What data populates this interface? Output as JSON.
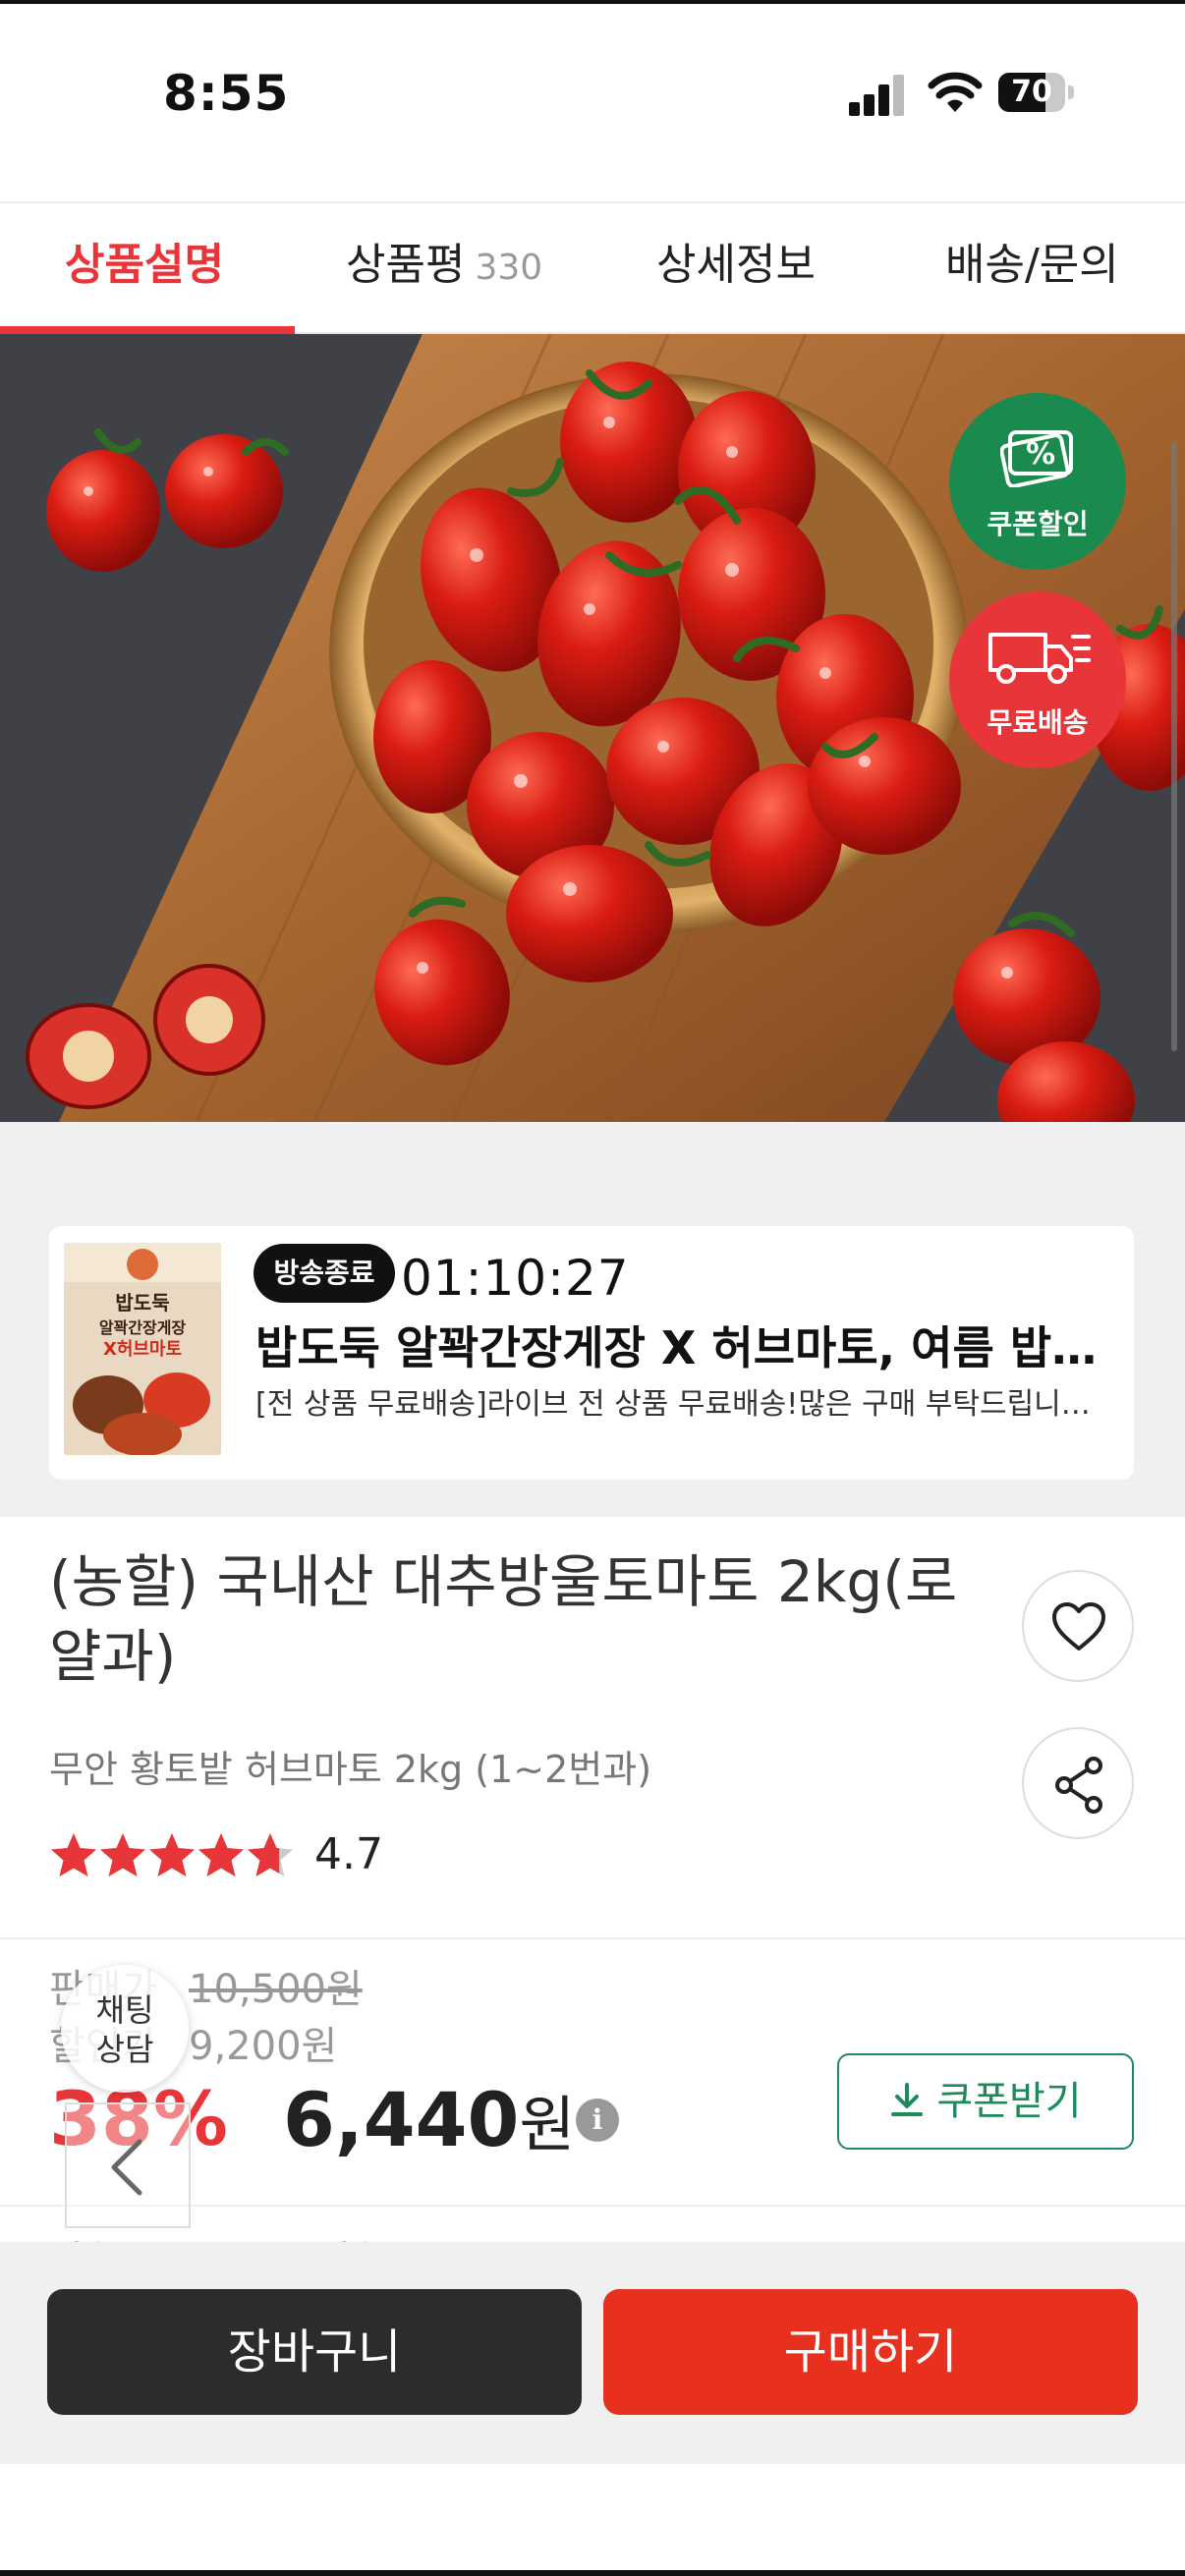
{
  "status_bar": {
    "time": "8:55",
    "battery": "70",
    "battery_level": 0.7
  },
  "tabs": [
    {
      "label": "상품설명",
      "active": true
    },
    {
      "label": "상품평",
      "count": "330",
      "active": false
    },
    {
      "label": "상세정보",
      "active": false
    },
    {
      "label": "배송/문의",
      "active": false
    }
  ],
  "hero": {
    "badges": [
      {
        "label": "쿠폰할인",
        "icon_text": "%",
        "icon": "coupon-icon",
        "color": "#1a8a4f"
      },
      {
        "label": "무료배송",
        "icon": "delivery-truck-icon",
        "color": "#e8353a"
      }
    ]
  },
  "live": {
    "status_chip": "방송종료",
    "timer": "01:10:27",
    "title": "밥도둑 알꽉간장게장 X 허브마토, 여름 밥…",
    "description": "[전 상품 무료배송]라이브 전 상품 무료배송!많은 구매 부탁드립니다😊[최…",
    "thumb_text": [
      "밥도둑",
      "알꽉간장게장",
      "X허브마토"
    ]
  },
  "product": {
    "title": "(농할) 국내산 대추방울토마토 2kg(로얄과)",
    "subtitle": "무안 황토밭 허브마토 2kg (1~2번과)",
    "rating": "4.7",
    "rating_value": 4.7,
    "wishlist_icon": "heart-icon",
    "share_icon": "share-icon"
  },
  "price": {
    "sale_label": "판매가",
    "original": "10,500원",
    "discount_label": "할인가",
    "discounted": "9,200원",
    "discount_rate": "38%",
    "final_amount": "6,440",
    "final_unit": "원",
    "info_icon": "i",
    "coupon_button": "쿠폰받기"
  },
  "peek_row": {
    "label": "배송",
    "value": "무료배송"
  },
  "chat": {
    "line1": "채팅",
    "line2": "상담"
  },
  "bottom": {
    "cart": "장바구니",
    "buy": "구매하기"
  },
  "colors": {
    "accent": "#e8353a",
    "buy": "#e8301f",
    "coupon_green": "#1e8a5a",
    "cart_dark": "#2c2c2c"
  }
}
